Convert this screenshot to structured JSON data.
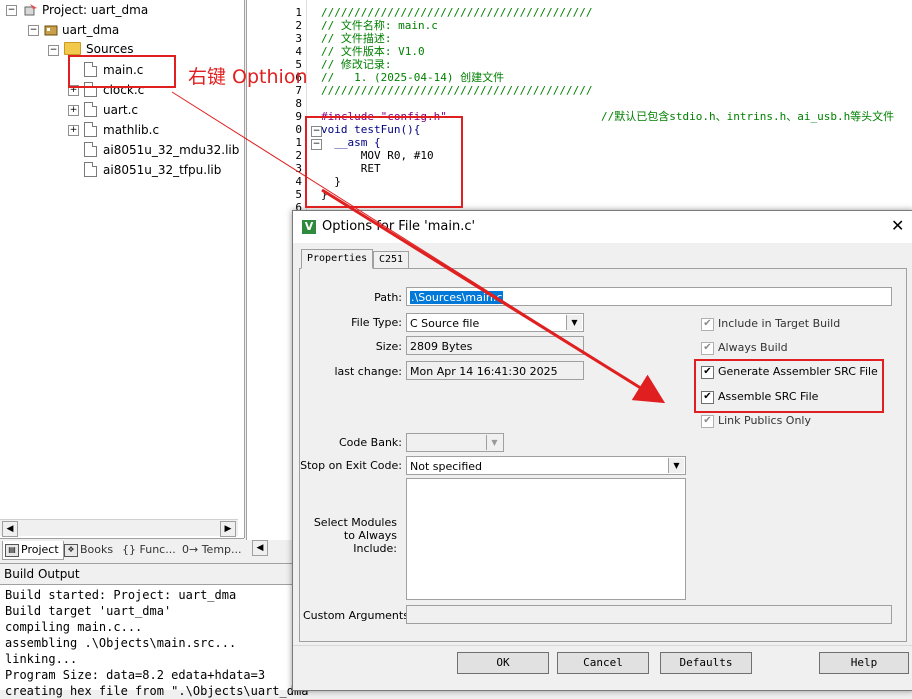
{
  "project_tree": {
    "project_label": "Project: uart_dma",
    "target_label": "uart_dma",
    "group_label": "Sources",
    "files": [
      "main.c",
      "clock.c",
      "uart.c",
      "mathlib.c",
      "ai8051u_32_mdu32.lib",
      "ai8051u_32_tfpu.lib"
    ]
  },
  "bottom_tabs": [
    "Project",
    "Books",
    "{} Func...",
    "0→ Temp..."
  ],
  "annotation_text": "右键 Opthion",
  "editor": {
    "line_numbers": [
      "1",
      "2",
      "3",
      "4",
      "5",
      "6",
      "7",
      "8",
      "9",
      "0",
      "1",
      "2",
      "3",
      "4",
      "5",
      "6"
    ],
    "lines": [
      "/////////////////////////////////////////",
      "// 文件名称: main.c",
      "// 文件描述:",
      "// 文件版本: V1.0",
      "// 修改记录:",
      "//   1. (2025-04-14) 创建文件",
      "/////////////////////////////////////////",
      "",
      "#include \"config.h\"",
      "void testFun(){",
      "  __asm {",
      "      MOV R0, #10",
      "      RET",
      "  }",
      "}",
      ""
    ],
    "include_comment": "//默认已包含stdio.h、intrins.h、ai_usb.h等头文件"
  },
  "build_output": {
    "title": "Build Output",
    "lines": [
      "Build started: Project: uart_dma",
      "Build target 'uart_dma'",
      "compiling main.c...",
      "assembling .\\Objects\\main.src...",
      "linking...",
      "Program Size: data=8.2 edata+hdata=3",
      "creating hex file from \".\\Objects\\uart_dma\""
    ]
  },
  "dialog": {
    "title": "Options for File 'main.c'",
    "tabs": [
      "Properties",
      "C251"
    ],
    "path_label": "Path:",
    "path_value": ".\\Sources\\main.c",
    "file_type_label": "File Type:",
    "file_type_value": "C Source file",
    "size_label": "Size:",
    "size_value": "2809 Bytes",
    "last_change_label": "last change:",
    "last_change_value": "Mon Apr 14 16:41:30 2025",
    "code_bank_label": "Code Bank:",
    "stop_on_exit_label": "Stop on Exit Code:",
    "stop_on_exit_value": "Not specified",
    "select_modules_label": "Select Modules\nto Always\nInclude:",
    "custom_args_label": "Custom Arguments:",
    "checkboxes": [
      {
        "label": "Include in Target Build",
        "checked": true,
        "enabled": false
      },
      {
        "label": "Always Build",
        "checked": true,
        "enabled": false
      },
      {
        "label": "Generate Assembler SRC File",
        "checked": true,
        "enabled": true
      },
      {
        "label": "Assemble SRC File",
        "checked": true,
        "enabled": true
      },
      {
        "label": "Link Publics Only",
        "checked": true,
        "enabled": false
      }
    ],
    "buttons": {
      "ok": "OK",
      "cancel": "Cancel",
      "defaults": "Defaults",
      "help": "Help"
    }
  },
  "colors": {
    "annotation_red": "#e02020",
    "comment_green": "#008000",
    "keyword_navy": "#000080"
  }
}
